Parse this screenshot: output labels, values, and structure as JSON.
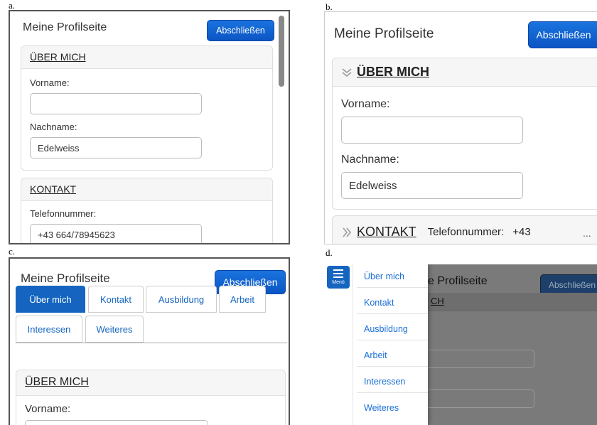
{
  "panel_labels": [
    "a.",
    "b.",
    "c.",
    "d."
  ],
  "page_title": "Meine Profilseite",
  "finish_button": "Abschließen",
  "about_heading": "ÜBER MICH",
  "contact_heading": "KONTAKT",
  "first_name_label": "Vorname:",
  "last_name_label": "Nachname:",
  "last_name_value": "Edelweiss",
  "phone_label": "Telefonnummer:",
  "phone_value": "+43 664/78945623",
  "phone_value_truncated": "+43",
  "ellipsis": "...",
  "tabs": [
    "Über mich",
    "Kontakt",
    "Ausbildung",
    "Arbeit",
    "Interessen",
    "Weiteres"
  ],
  "menu_button_label": "Menü",
  "menu_items": [
    "Über mich",
    "Kontakt",
    "Ausbildung",
    "Arbeit",
    "Interessen",
    "Weiteres"
  ],
  "overlay_title_fragment": "e Profilseite",
  "overlay_heading_fragment": "CH",
  "icons": {
    "expanded": "chevron-double-down-icon",
    "collapsed": "chevron-double-right-icon",
    "menu": "hamburger-icon"
  },
  "colors": {
    "primary": "#1565c0",
    "link": "#1a6fd6"
  }
}
